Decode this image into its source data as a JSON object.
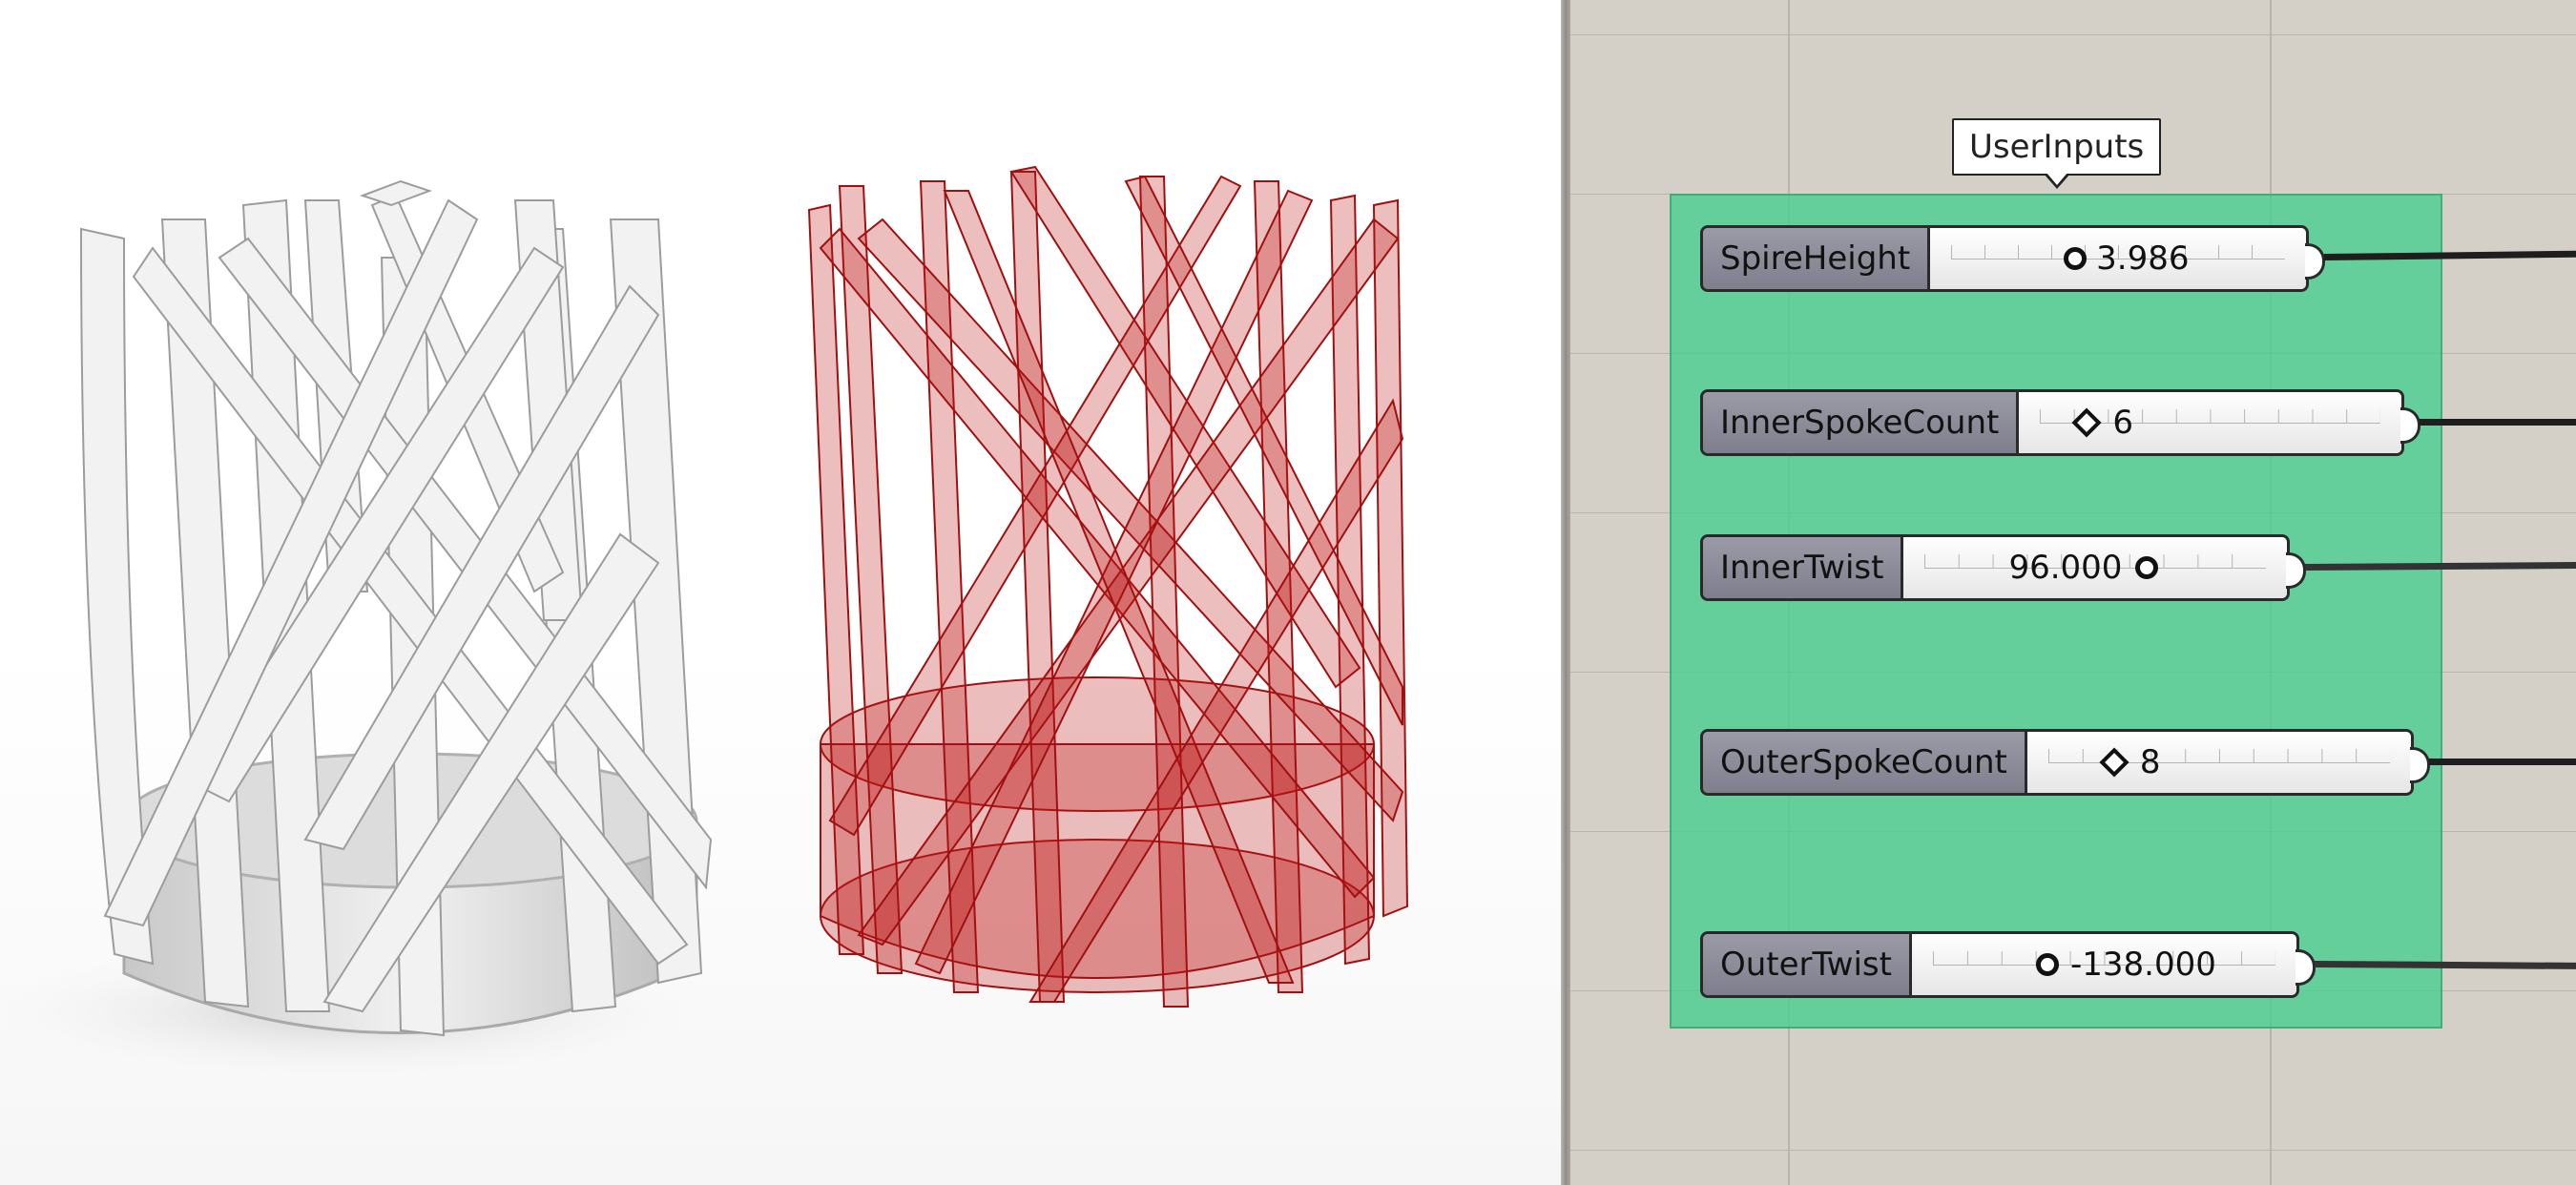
{
  "canvas": {
    "group": {
      "label": "UserInputs",
      "sliders": [
        {
          "name": "SpireHeight",
          "value": "3.986",
          "knob": "circle"
        },
        {
          "name": "InnerSpokeCount",
          "value": "6",
          "knob": "diamond"
        },
        {
          "name": "InnerTwist",
          "value": "96.000",
          "knob": "circle"
        },
        {
          "name": "OuterSpokeCount",
          "value": "8",
          "knob": "diamond"
        },
        {
          "name": "OuterTwist",
          "value": "-138.000",
          "knob": "circle"
        }
      ]
    }
  },
  "colors": {
    "group_fill": "#45CE8F",
    "canvas_bg": "#D4D0C8",
    "ghosted_model": "#B01010",
    "solid_model": "#EDEDED"
  }
}
